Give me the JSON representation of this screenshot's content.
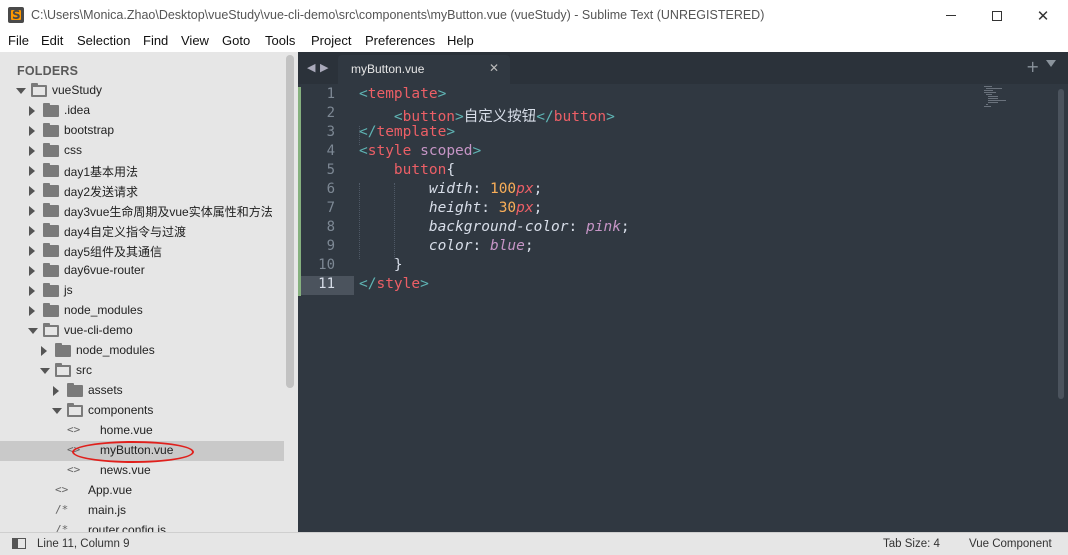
{
  "window": {
    "title": "C:\\Users\\Monica.Zhao\\Desktop\\vueStudy\\vue-cli-demo\\src\\components\\myButton.vue (vueStudy) - Sublime Text (UNREGISTERED)",
    "app_icon": "sublime-text-icon",
    "controls": {
      "minimize": "minimize-icon",
      "maximize": "maximize-icon",
      "close": "✕"
    }
  },
  "menu": {
    "items": [
      "File",
      "Edit",
      "Selection",
      "Find",
      "View",
      "Goto",
      "Tools",
      "Project",
      "Preferences",
      "Help"
    ]
  },
  "sidebar": {
    "header": "FOLDERS",
    "tree": [
      {
        "label": "vueStudy",
        "type": "folder",
        "expanded": true,
        "depth": 0
      },
      {
        "label": ".idea",
        "type": "folder",
        "expanded": false,
        "depth": 1
      },
      {
        "label": "bootstrap",
        "type": "folder",
        "expanded": false,
        "depth": 1
      },
      {
        "label": "css",
        "type": "folder",
        "expanded": false,
        "depth": 1
      },
      {
        "label": "day1基本用法",
        "type": "folder",
        "expanded": false,
        "depth": 1
      },
      {
        "label": "day2发送请求",
        "type": "folder",
        "expanded": false,
        "depth": 1
      },
      {
        "label": "day3vue生命周期及vue实体属性和方法",
        "type": "folder",
        "expanded": false,
        "depth": 1
      },
      {
        "label": "day4自定义指令与过渡",
        "type": "folder",
        "expanded": false,
        "depth": 1
      },
      {
        "label": "day5组件及其通信",
        "type": "folder",
        "expanded": false,
        "depth": 1
      },
      {
        "label": "day6vue-router",
        "type": "folder",
        "expanded": false,
        "depth": 1
      },
      {
        "label": "js",
        "type": "folder",
        "expanded": false,
        "depth": 1
      },
      {
        "label": "node_modules",
        "type": "folder",
        "expanded": false,
        "depth": 1
      },
      {
        "label": "vue-cli-demo",
        "type": "folder",
        "expanded": true,
        "depth": 1
      },
      {
        "label": "node_modules",
        "type": "folder",
        "expanded": false,
        "depth": 2
      },
      {
        "label": "src",
        "type": "folder",
        "expanded": true,
        "depth": 2
      },
      {
        "label": "assets",
        "type": "folder",
        "expanded": false,
        "depth": 3
      },
      {
        "label": "components",
        "type": "folder",
        "expanded": true,
        "depth": 3
      },
      {
        "label": "home.vue",
        "type": "file",
        "glyph": "<>",
        "depth": 4
      },
      {
        "label": "myButton.vue",
        "type": "file",
        "glyph": "<>",
        "depth": 4,
        "selected": true
      },
      {
        "label": "news.vue",
        "type": "file",
        "glyph": "<>",
        "depth": 4
      },
      {
        "label": "App.vue",
        "type": "file",
        "glyph": "<>",
        "depth": 3
      },
      {
        "label": "main.js",
        "type": "file",
        "glyph": "/*",
        "depth": 3
      },
      {
        "label": "router.config.js",
        "type": "file",
        "glyph": "/*",
        "depth": 3
      }
    ]
  },
  "editor": {
    "tab": {
      "label": "myButton.vue",
      "close": "✕"
    },
    "nav_left": "◀",
    "nav_right": "▶",
    "new_tab": "+",
    "active_line": 11,
    "lines": [
      {
        "num": "1",
        "tokens": [
          [
            "t-tag",
            "<"
          ],
          [
            "t-name",
            "template"
          ],
          [
            "t-tag",
            ">"
          ]
        ]
      },
      {
        "num": "2",
        "tokens": [
          [
            "t-txt",
            "    "
          ],
          [
            "t-tag",
            "<"
          ],
          [
            "t-name",
            "button"
          ],
          [
            "t-tag",
            ">"
          ],
          [
            "t-txt",
            "自定义按钮"
          ],
          [
            "t-tag",
            "</"
          ],
          [
            "t-name",
            "button"
          ],
          [
            "t-tag",
            ">"
          ]
        ]
      },
      {
        "num": "3",
        "tokens": [
          [
            "t-tag",
            "</"
          ],
          [
            "t-name",
            "template"
          ],
          [
            "t-tag",
            ">"
          ]
        ]
      },
      {
        "num": "4",
        "tokens": [
          [
            "t-tag",
            "<"
          ],
          [
            "t-name",
            "style"
          ],
          [
            "t-txt",
            " "
          ],
          [
            "t-attr",
            "scoped"
          ],
          [
            "t-tag",
            ">"
          ]
        ]
      },
      {
        "num": "5",
        "tokens": [
          [
            "t-txt",
            "    "
          ],
          [
            "t-sel",
            "button"
          ],
          [
            "t-punc",
            "{"
          ]
        ]
      },
      {
        "num": "6",
        "tokens": [
          [
            "t-txt",
            "        "
          ],
          [
            "t-prop",
            "width"
          ],
          [
            "t-punc",
            ": "
          ],
          [
            "t-num",
            "100"
          ],
          [
            "t-unit",
            "px"
          ],
          [
            "t-punc",
            ";"
          ]
        ]
      },
      {
        "num": "7",
        "tokens": [
          [
            "t-txt",
            "        "
          ],
          [
            "t-prop",
            "height"
          ],
          [
            "t-punc",
            ": "
          ],
          [
            "t-num",
            "30"
          ],
          [
            "t-unit",
            "px"
          ],
          [
            "t-punc",
            ";"
          ]
        ]
      },
      {
        "num": "8",
        "tokens": [
          [
            "t-txt",
            "        "
          ],
          [
            "t-prop",
            "background-color"
          ],
          [
            "t-punc",
            ": "
          ],
          [
            "t-kw",
            "pink"
          ],
          [
            "t-punc",
            ";"
          ]
        ]
      },
      {
        "num": "9",
        "tokens": [
          [
            "t-txt",
            "        "
          ],
          [
            "t-prop",
            "color"
          ],
          [
            "t-punc",
            ": "
          ],
          [
            "t-kw",
            "blue"
          ],
          [
            "t-punc",
            ";"
          ]
        ]
      },
      {
        "num": "10",
        "tokens": [
          [
            "t-txt",
            "    "
          ],
          [
            "t-punc",
            "}"
          ]
        ]
      },
      {
        "num": "11",
        "tokens": [
          [
            "t-tag",
            "</"
          ],
          [
            "t-name",
            "style"
          ],
          [
            "t-tag",
            ">"
          ]
        ]
      }
    ]
  },
  "statusbar": {
    "position": "Line 11, Column 9",
    "tab_size": "Tab Size: 4",
    "syntax": "Vue Component"
  },
  "colors": {
    "editor_bg": "#303841",
    "sidebar_bg": "#e6e6e6",
    "selection_highlight": "#e0201c",
    "modified_gutter": "#86b17f"
  }
}
